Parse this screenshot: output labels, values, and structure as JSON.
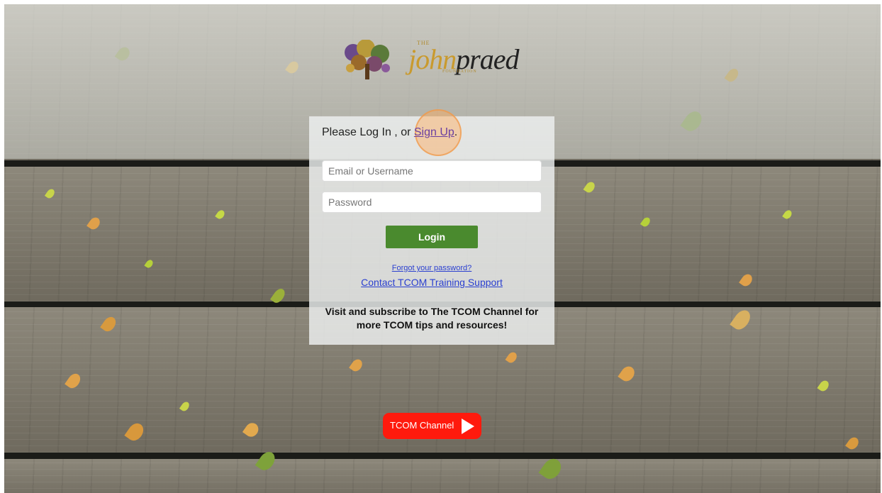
{
  "logo": {
    "the": "THE",
    "script_gold": "john",
    "script_dark": "praed",
    "subtitle": "FOUNDATION"
  },
  "login": {
    "prompt_prefix": "Please Log In , or ",
    "signup_link": "Sign Up",
    "prompt_suffix": ".",
    "email_placeholder": "Email or Username",
    "password_placeholder": "Password",
    "login_button": "Login",
    "forgot_link": "Forgot your password?",
    "contact_link": "Contact TCOM Training Support",
    "visit_text": "Visit and subscribe to The TCOM Channel for more TCOM tips and resources!"
  },
  "youtube": {
    "label": "TCOM Channel",
    "icon": "play-icon"
  },
  "colors": {
    "login_button": "#4a8a2e",
    "link": "#2a3fd0",
    "signup_link": "#6b3fa0",
    "youtube_red": "#ff1a0d",
    "logo_gold": "#c99a2e"
  }
}
